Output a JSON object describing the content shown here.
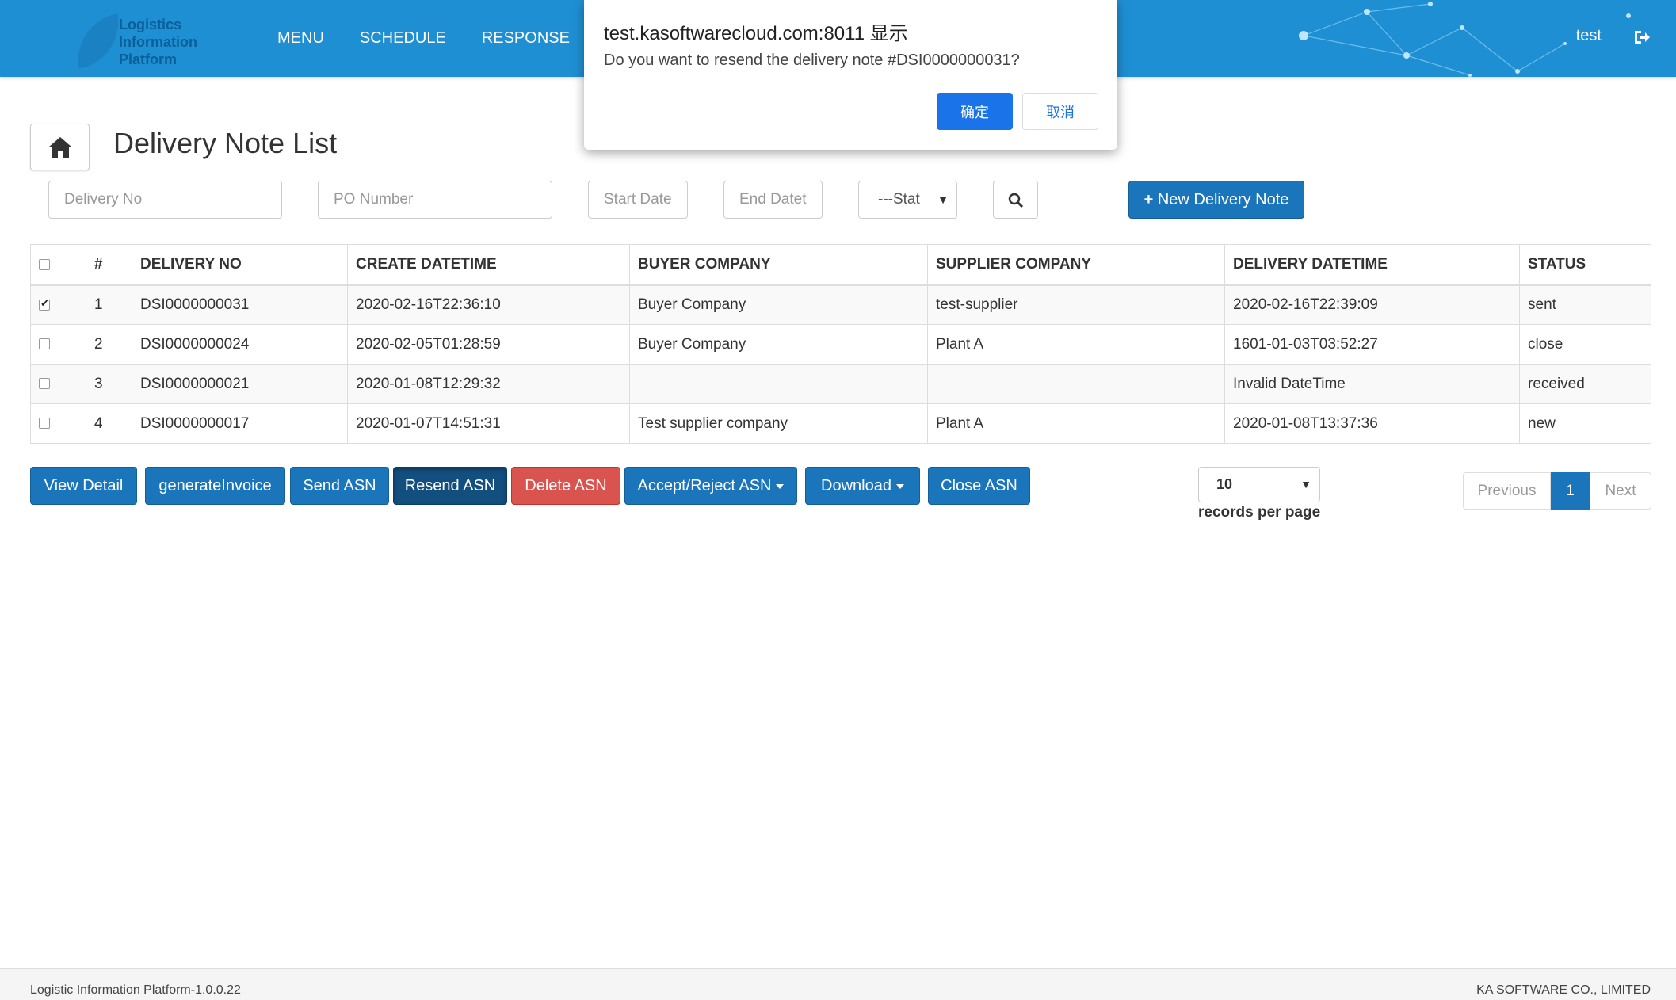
{
  "header": {
    "logo_lines": [
      "Logistics",
      "Information",
      "Platform"
    ],
    "nav": [
      "MENU",
      "SCHEDULE",
      "RESPONSE"
    ],
    "user": "test"
  },
  "dialog": {
    "title": "test.kasoftwarecloud.com:8011 显示",
    "message": "Do you want to resend the delivery note #DSI0000000031?",
    "ok_label": "确定",
    "cancel_label": "取消"
  },
  "page": {
    "title": "Delivery Note List"
  },
  "filters": {
    "delivery_no_placeholder": "Delivery No",
    "po_number_placeholder": "PO Number",
    "start_date_placeholder": "Start Date",
    "end_date_placeholder": "End Datet",
    "status_selected": "---Stat",
    "new_button": "New Delivery Note"
  },
  "table": {
    "headers": [
      "#",
      "DELIVERY NO",
      "CREATE DATETIME",
      "BUYER COMPANY",
      "SUPPLIER COMPANY",
      "DELIVERY DATETIME",
      "STATUS"
    ],
    "rows": [
      {
        "checked": true,
        "num": "1",
        "delivery_no": "DSI0000000031",
        "create": "2020-02-16T22:36:10",
        "buyer": "Buyer Company",
        "supplier": "test-supplier",
        "delivery": "2020-02-16T22:39:09",
        "status": "sent"
      },
      {
        "checked": false,
        "num": "2",
        "delivery_no": "DSI0000000024",
        "create": "2020-02-05T01:28:59",
        "buyer": "Buyer Company",
        "supplier": "Plant A",
        "delivery": "1601-01-03T03:52:27",
        "status": "close"
      },
      {
        "checked": false,
        "num": "3",
        "delivery_no": "DSI0000000021",
        "create": "2020-01-08T12:29:32",
        "buyer": "",
        "supplier": "",
        "delivery": "Invalid DateTime",
        "status": "received"
      },
      {
        "checked": false,
        "num": "4",
        "delivery_no": "DSI0000000017",
        "create": "2020-01-07T14:51:31",
        "buyer": "Test supplier company",
        "supplier": "Plant A",
        "delivery": "2020-01-08T13:37:36",
        "status": "new"
      }
    ]
  },
  "actions": {
    "view_detail": "View Detail",
    "generate_invoice": "generateInvoice",
    "send_asn": "Send ASN",
    "resend_asn": "Resend ASN",
    "delete_asn": "Delete ASN",
    "accept_reject_asn": "Accept/Reject ASN",
    "download": "Download",
    "close_asn": "Close ASN"
  },
  "paging": {
    "records_per_page_value": "10",
    "records_per_page_label": "records per page",
    "previous": "Previous",
    "current": "1",
    "next": "Next"
  },
  "footer": {
    "left": "Logistic Information Platform-1.0.0.22",
    "right": "KA SOFTWARE CO., LIMITED"
  },
  "colors": {
    "header_bg": "#1f8fd3",
    "primary": "#1b75bb",
    "danger": "#d9534f",
    "dialog_ok": "#1a73e8"
  }
}
